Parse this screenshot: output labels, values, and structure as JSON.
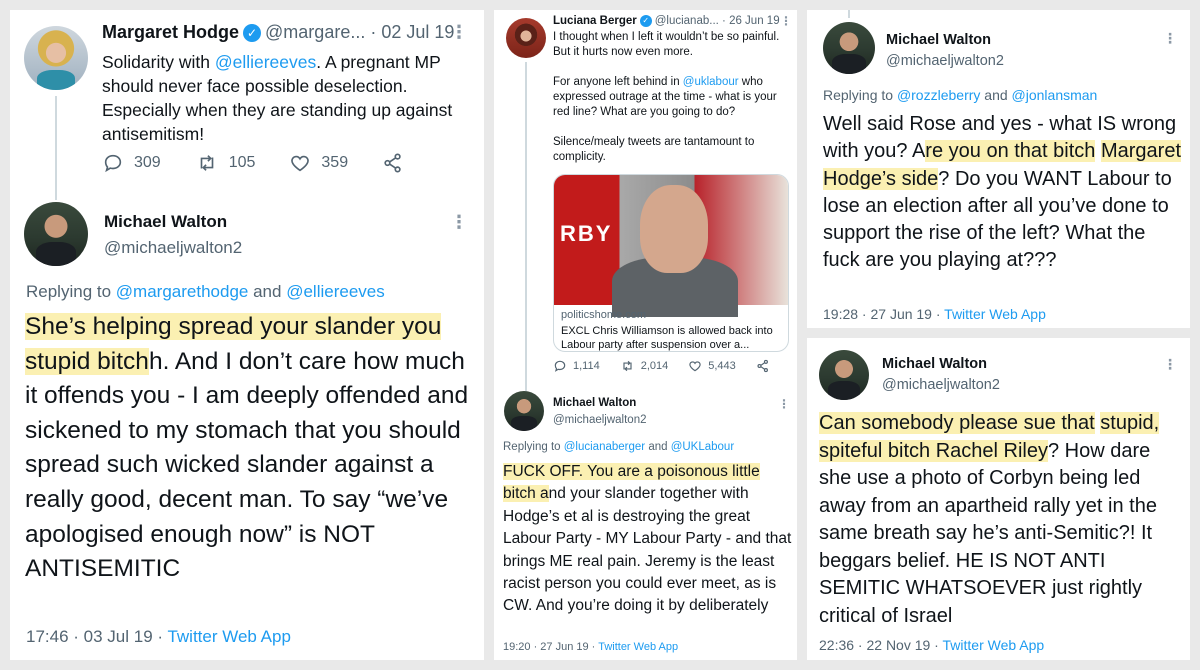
{
  "panel1": {
    "tweet": {
      "author": "Margaret Hodge",
      "handle": "@margare...",
      "date": "· 02 Jul 19",
      "text_before": "Solidarity with ",
      "mention": "@elliereeves",
      "text_after": ". A pregnant MP should never face possible deselection. Especially when they are standing up against antisemitism!",
      "replies": "309",
      "retweets": "105",
      "likes": "359"
    },
    "reply": {
      "author": "Michael Walton",
      "handle": "@michaeljwalton2",
      "replying_label": "Replying to",
      "replying_to_1": "@margarethodge",
      "replying_and": "and",
      "replying_to_2": "@elliereeves",
      "hl_1": "She’s helping spread your slander you s",
      "hl_2": "tupid bitch",
      "text_rest": "h. And I don’t care how much it offends you - I am deeply offended and sickened to my stomach that you should spread such wicked slander against a really good, decent man. To say “we’ve apologised enough now” is NOT ANTISEMITIC",
      "time": "17:46 · 03 Jul 19 ·",
      "source": "Twitter Web App"
    }
  },
  "panel2": {
    "tweet": {
      "author": "Luciana Berger",
      "handle": "@lucianab...",
      "date": "· 26 Jun 19",
      "text_1": "I thought when I left it wouldn’t be so painful. But it hurts now even more.",
      "text_2_before": "For anyone left behind in ",
      "mention": "@uklabour",
      "text_2_after": " who expressed outrage at the time - what is your red line? What are you going to do?",
      "text_3": "Silence/mealy tweets are tantamount to complicity.",
      "card_domain": "politicshome.com",
      "card_title": "EXCL Chris Williamson is allowed back into Labour party after suspension over a...",
      "card_image_text": "RBY",
      "replies": "1,114",
      "retweets": "2,014",
      "likes": "5,443"
    },
    "reply": {
      "author": "Michael Walton",
      "handle": "@michaeljwalton2",
      "replying_label": "Replying to",
      "replying_to_1": "@lucianaberger",
      "replying_and": "and",
      "replying_to_2": "@UKLabour",
      "hl_1": "FUCK OFF. You are a poisonous little",
      "hl_2": "bitch a",
      "text_rest": "nd your slander together with Hodge’s et al is destroying the great Labour Party - MY Labour Party - and that brings ME real pain. Jeremy is the least racist person you could ever meet, as is CW. And you’re doing it by deliberately",
      "time": "19:20 · 27 Jun 19 ·",
      "source": "Twitter Web App"
    }
  },
  "panel3": {
    "author": "Michael Walton",
    "handle": "@michaeljwalton2",
    "replying_label": "Replying to",
    "replying_to_1": "@rozzleberry",
    "replying_and": "and",
    "replying_to_2": "@jonlansman",
    "text_before": "Well said Rose and yes - what IS wrong with you? A",
    "hl_1": "re you on that bitch",
    "hl_2": "Margaret Hodge’s side",
    "text_after": "? Do you WANT Labour to lose an election after all you’ve done to support the rise of the left? What the fuck are you playing at???",
    "time": "19:28 · 27 Jun 19 ·",
    "source": "Twitter Web App"
  },
  "panel4": {
    "author": "Michael Walton",
    "handle": "@michaeljwalton2",
    "hl_1": "Can somebody please sue that",
    "hl_2": "stupid, spiteful bitch Rachel Riley",
    "text_after": "? How dare she use a photo of Corbyn being led away from an apartheid rally yet in the same breath say he’s anti-Semitic?! It beggars belief. HE IS NOT ANTI SEMITIC WHATSOEVER just rightly critical of Israel",
    "time": "22:36 · 22 Nov 19 ·",
    "source": "Twitter Web App"
  },
  "icons": [
    "reply-icon",
    "retweet-icon",
    "like-icon",
    "share-icon",
    "more-icon",
    "verified-badge-icon"
  ],
  "colors": {
    "link": "#1d9bf0",
    "highlight": "#fbf0b2",
    "muted": "#536471",
    "verified": "#1d9bf0"
  }
}
